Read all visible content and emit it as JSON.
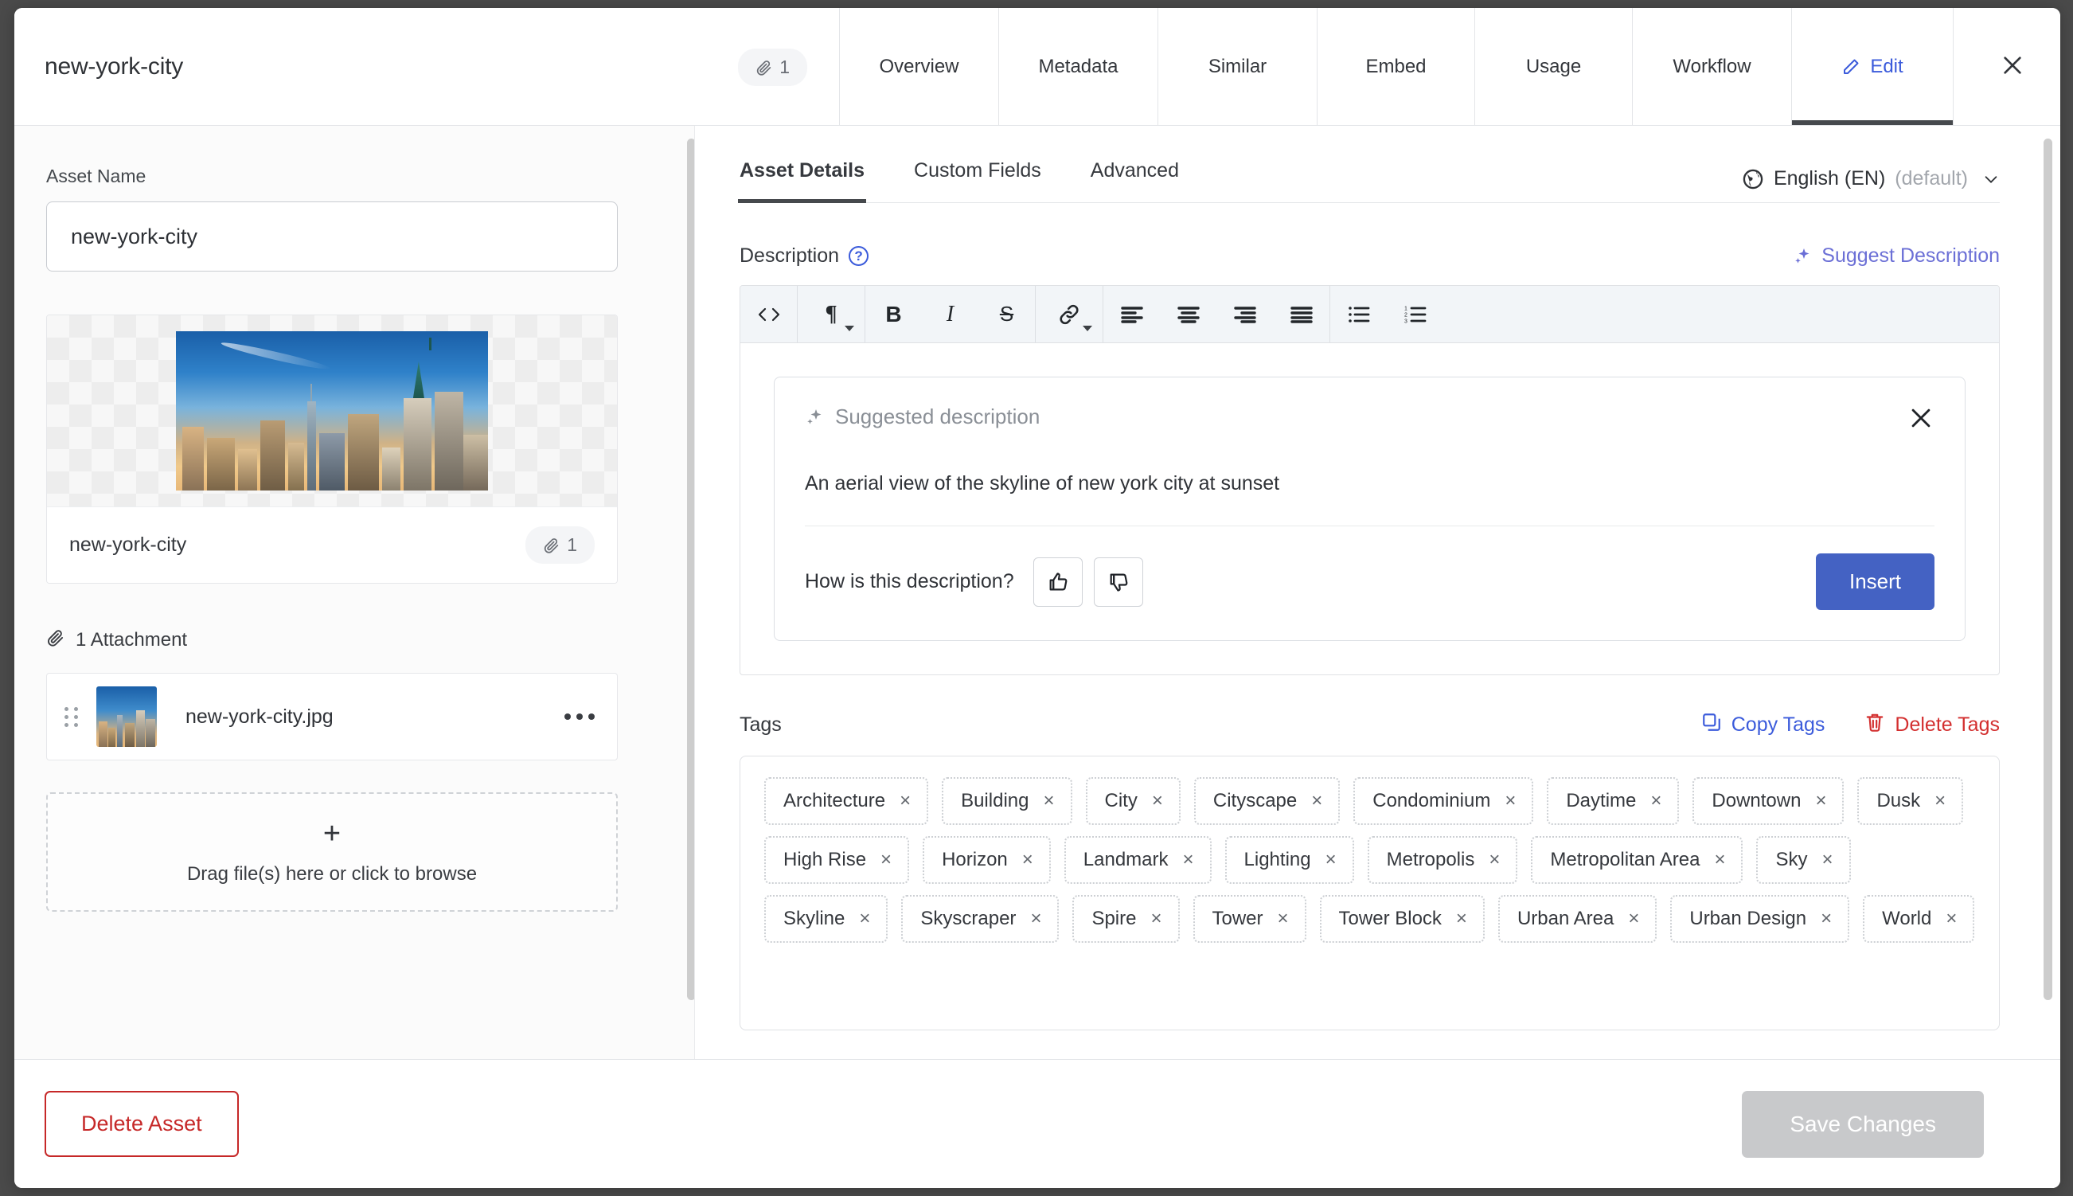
{
  "header": {
    "asset_title": "new-york-city",
    "attachment_badge_count": "1",
    "attachment_badge_icon": "paperclip-icon",
    "close_icon": "close-icon",
    "tabs": [
      {
        "label": "Overview",
        "active": false
      },
      {
        "label": "Metadata",
        "active": false
      },
      {
        "label": "Similar",
        "active": false
      },
      {
        "label": "Embed",
        "active": false
      },
      {
        "label": "Usage",
        "active": false
      },
      {
        "label": "Workflow",
        "active": false
      },
      {
        "label": "Edit",
        "active": true,
        "icon": "pencil-icon"
      }
    ]
  },
  "left_panel": {
    "asset_name_label": "Asset Name",
    "asset_name_value": "new-york-city",
    "asset_name_placeholder": "Asset Name",
    "preview_caption": "new-york-city",
    "preview_badge_count": "1",
    "attachments_heading": "1 Attachment",
    "attachment_row": {
      "filename": "new-york-city.jpg",
      "drag_handle_icon": "drag-handle-icon",
      "overflow_icon": "more-options-icon"
    },
    "dropzone": {
      "plus": "+",
      "text": "Drag file(s) here or click to browse"
    }
  },
  "right_panel": {
    "sub_tabs": [
      {
        "label": "Asset Details",
        "active": true
      },
      {
        "label": "Custom Fields",
        "active": false
      },
      {
        "label": "Advanced",
        "active": false
      }
    ],
    "language": {
      "globe_icon": "globe-icon",
      "name": "English (EN)",
      "default_suffix": "(default)",
      "chevron_icon": "chevron-down-icon"
    },
    "description": {
      "label": "Description",
      "help_icon": "help-question-icon",
      "suggest_link": "Suggest Description",
      "suggest_icon": "sparkle-icon",
      "toolbar": [
        {
          "name": "code-block-icon",
          "glyph": "<>"
        },
        {
          "name": "paragraph-style-icon",
          "glyph": "¶",
          "caret": true
        },
        {
          "name": "bold-icon",
          "glyph": "B"
        },
        {
          "name": "italic-icon",
          "glyph": "I"
        },
        {
          "name": "strikethrough-icon",
          "glyph": "S"
        },
        {
          "name": "link-icon",
          "glyph": "link",
          "caret": true
        },
        {
          "name": "align-left-icon",
          "glyph": "align-left"
        },
        {
          "name": "align-center-icon",
          "glyph": "align-center"
        },
        {
          "name": "align-right-icon",
          "glyph": "align-right"
        },
        {
          "name": "align-justify-icon",
          "glyph": "align-justify"
        },
        {
          "name": "bulleted-list-icon",
          "glyph": "ul"
        },
        {
          "name": "numbered-list-icon",
          "glyph": "ol"
        }
      ]
    },
    "suggestion_card": {
      "title": "Suggested description",
      "title_icon": "sparkle-icon",
      "close_icon": "close-icon",
      "text": "An aerial view of the skyline of new york city at sunset",
      "feedback_question": "How is this description?",
      "thumbs_up_icon": "thumbs-up-icon",
      "thumbs_down_icon": "thumbs-down-icon",
      "insert_label": "Insert"
    },
    "tags": {
      "label": "Tags",
      "copy_label": "Copy Tags",
      "copy_icon": "copy-icon",
      "delete_label": "Delete Tags",
      "delete_icon": "trash-icon",
      "remove_glyph": "×",
      "items": [
        "Architecture",
        "Building",
        "City",
        "Cityscape",
        "Condominium",
        "Daytime",
        "Downtown",
        "Dusk",
        "High Rise",
        "Horizon",
        "Landmark",
        "Lighting",
        "Metropolis",
        "Metropolitan Area",
        "Sky",
        "Skyline",
        "Skyscraper",
        "Spire",
        "Tower",
        "Tower Block",
        "Urban Area",
        "Urban Design",
        "World"
      ]
    }
  },
  "footer": {
    "delete_label": "Delete Asset",
    "save_label": "Save Changes",
    "save_disabled": true
  },
  "colors": {
    "accent_blue": "#3b5bdb",
    "insert_blue": "#4462c3",
    "suggest_purple": "#6b6fd6",
    "danger_red": "#c62828",
    "delete_tags_red": "#d32f2f",
    "active_tab_indicator": "#46494d",
    "disabled_grey": "#c8c9cb",
    "backdrop": "#4a4a4a"
  }
}
